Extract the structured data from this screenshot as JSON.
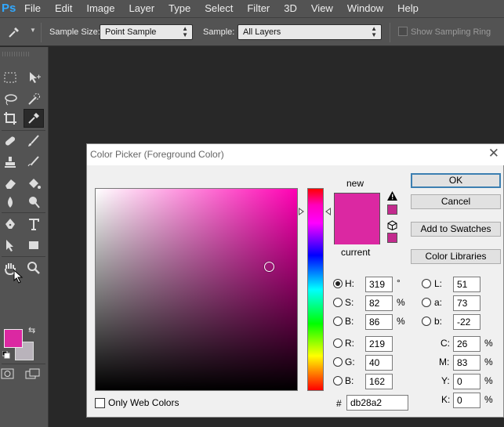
{
  "app": {
    "logo": "Ps"
  },
  "menu": [
    "File",
    "Edit",
    "Image",
    "Layer",
    "Type",
    "Select",
    "Filter",
    "3D",
    "View",
    "Window",
    "Help"
  ],
  "options_bar": {
    "sample_size_label": "Sample Size:",
    "sample_size_value": "Point Sample",
    "sample_label": "Sample:",
    "sample_value": "All Layers",
    "show_ring_label": "Show Sampling Ring"
  },
  "tools": {
    "foreground_color": "#db28a2",
    "background_color": "#b9b3bb",
    "icons": [
      "marquee-icon",
      "move-icon",
      "lasso-icon",
      "quick-select-icon",
      "crop-icon",
      "eyedropper-icon",
      "healing-icon",
      "brush-icon",
      "stamp-icon",
      "history-brush-icon",
      "eraser-icon",
      "paint-bucket-icon",
      "blur-icon",
      "dodge-icon",
      "pen-icon",
      "type-icon",
      "path-select-icon",
      "shape-icon",
      "hand-icon",
      "zoom-icon"
    ]
  },
  "dialog": {
    "title": "Color Picker (Foreground Color)",
    "new_label": "new",
    "current_label": "current",
    "new_color": "#db28a2",
    "current_color": "#db28a2",
    "buttons": {
      "ok": "OK",
      "cancel": "Cancel",
      "add_to_swatches": "Add to Swatches",
      "color_libraries": "Color Libraries"
    },
    "hsb": [
      {
        "label": "H:",
        "value": "319",
        "unit": "°",
        "selected": true
      },
      {
        "label": "S:",
        "value": "82",
        "unit": "%",
        "selected": false
      },
      {
        "label": "B:",
        "value": "86",
        "unit": "%",
        "selected": false
      }
    ],
    "rgb": [
      {
        "label": "R:",
        "value": "219"
      },
      {
        "label": "G:",
        "value": "40"
      },
      {
        "label": "B:",
        "value": "162"
      }
    ],
    "lab": [
      {
        "label": "L:",
        "value": "51"
      },
      {
        "label": "a:",
        "value": "73"
      },
      {
        "label": "b:",
        "value": "-22"
      }
    ],
    "cmyk": [
      {
        "label": "C:",
        "value": "26",
        "unit": "%"
      },
      {
        "label": "M:",
        "value": "83",
        "unit": "%"
      },
      {
        "label": "Y:",
        "value": "0",
        "unit": "%"
      },
      {
        "label": "K:",
        "value": "0",
        "unit": "%"
      }
    ],
    "hex_label": "#",
    "hex_value": "db28a2",
    "only_web_colors_label": "Only Web Colors"
  }
}
